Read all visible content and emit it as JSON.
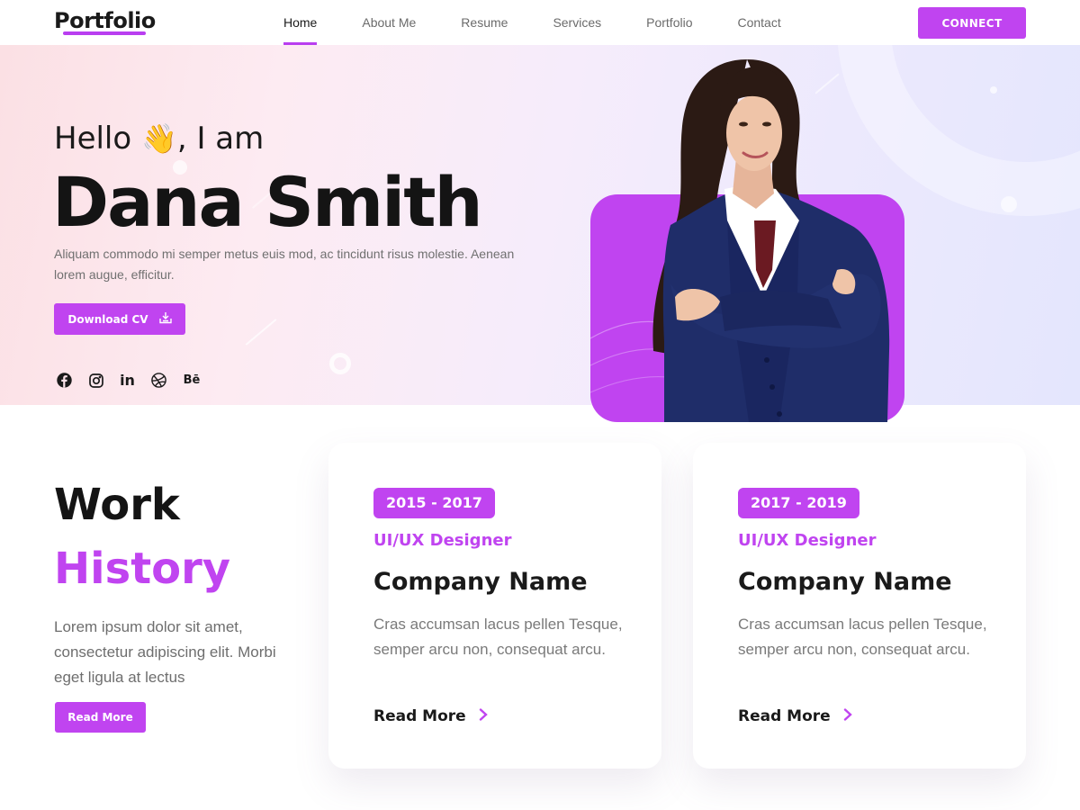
{
  "nav": {
    "logo": "Portfolio",
    "links": [
      {
        "label": "Home",
        "active": true
      },
      {
        "label": "About Me"
      },
      {
        "label": "Resume"
      },
      {
        "label": "Services"
      },
      {
        "label": "Portfolio"
      },
      {
        "label": "Contact"
      }
    ],
    "connect_label": "CONNECT"
  },
  "hero": {
    "greeting_prefix": "Hello",
    "greeting_emoji": "👋",
    "greeting_suffix": ", I am",
    "name": "Dana Smith",
    "description": "Aliquam commodo mi semper metus euis mod, ac tincidunt risus molestie. Aenean lorem augue, efficitur.",
    "download_label": "Download CV",
    "download_icon": "download-tray-icon",
    "socials": [
      {
        "name": "facebook-icon"
      },
      {
        "name": "instagram-icon"
      },
      {
        "name": "linkedin-icon",
        "text": "in"
      },
      {
        "name": "dribbble-icon"
      },
      {
        "name": "behance-icon",
        "text": "Bē"
      }
    ]
  },
  "work_history": {
    "title_line1": "Work",
    "title_line2": "History",
    "description": "Lorem ipsum dolor sit amet, consectetur adipiscing elit. Morbi eget ligula at lectus",
    "read_more_label": "Read More",
    "jobs": [
      {
        "period": "2015 - 2017",
        "role": "UI/UX Designer",
        "company": "Company Name",
        "description": "Cras accumsan lacus pellen Tesque, semper arcu non, consequat arcu.",
        "read_more": "Read More"
      },
      {
        "period": "2017 - 2019",
        "role": "UI/UX Designer",
        "company": "Company Name",
        "description": "Cras accumsan lacus pellen Tesque, semper arcu non, consequat arcu.",
        "read_more": "Read More"
      }
    ]
  },
  "colors": {
    "accent": "#c044f0",
    "text_dark": "#1a1a1a",
    "text_muted": "#707070",
    "hero_gradient_start": "#fbe0e4",
    "hero_gradient_end": "#e4e6fd"
  }
}
